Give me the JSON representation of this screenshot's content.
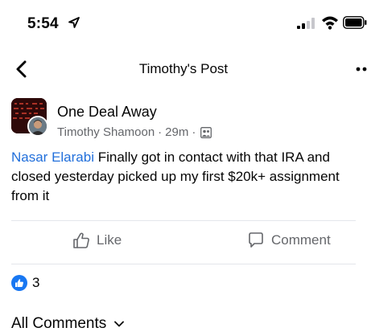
{
  "status_bar": {
    "time": "5:54"
  },
  "nav": {
    "title": "Timothy's Post"
  },
  "post": {
    "group_name": "One Deal Away",
    "author": "Timothy Shamoon",
    "separator": "·",
    "time_ago": "29m",
    "mention": "Nasar Elarabi",
    "text": " Finally got in contact with that IRA and closed yesterday picked up my first $20k+ assignment from it"
  },
  "actions": {
    "like_label": "Like",
    "comment_label": "Comment"
  },
  "reactions": {
    "count": "3"
  },
  "comments": {
    "label": "All Comments"
  },
  "colors": {
    "accent": "#1877f2",
    "mention": "#216fdb",
    "secondary_text": "#65676b"
  }
}
